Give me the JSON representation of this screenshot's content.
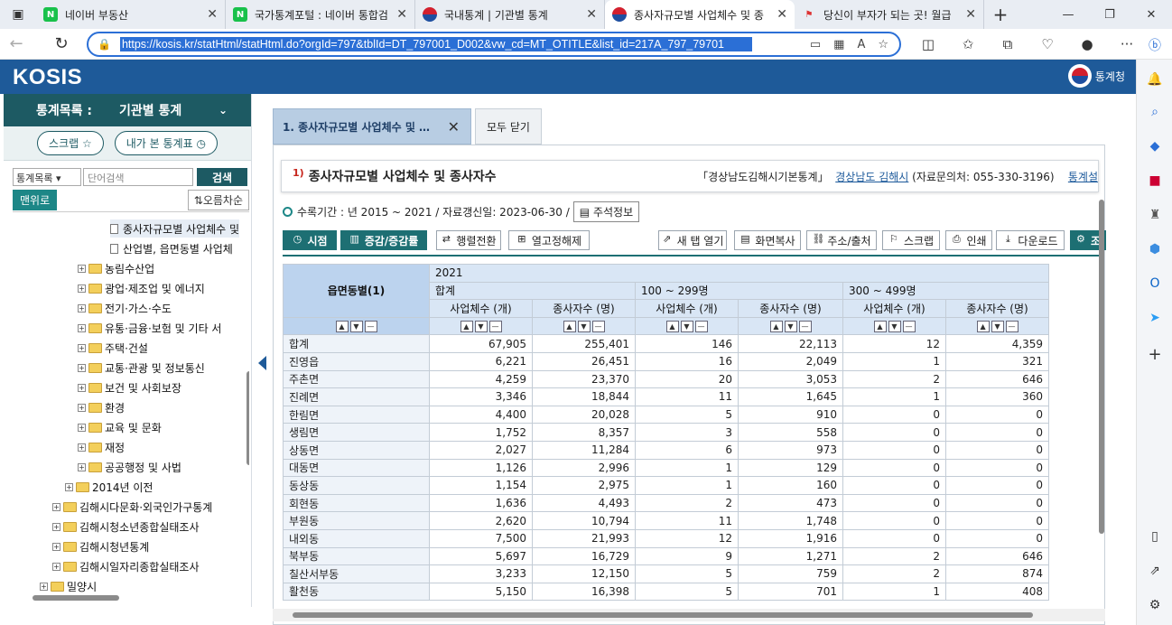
{
  "browser": {
    "tabs": [
      {
        "title": "네이버 부동산",
        "favicon": "N",
        "color": "#19c14b"
      },
      {
        "title": "국가통계포털 : 네이버 통합검",
        "favicon": "N",
        "color": "#19c14b"
      },
      {
        "title": "국내통계 | 기관별 통계",
        "favicon": "kosis-icon",
        "color": "#1e4fa0"
      },
      {
        "title": "종사자규모별 사업체수 및 종",
        "favicon": "kosis-icon",
        "color": "#1e4fa0"
      },
      {
        "title": "당신이 부자가 되는 곳! 월급",
        "favicon": "flag-icon",
        "color": "#d33"
      }
    ],
    "url": "https://kosis.kr/statHtml/statHtml.do?orgId=797&tblId=DT_797001_D002&vw_cd=MT_OTITLE&list_id=217A_797_79701"
  },
  "header": {
    "logo": "KOSIS",
    "org": "통계청"
  },
  "left": {
    "title": "통계목록 :",
    "selected": "기관별 통계",
    "scrap": "스크랩 ☆",
    "my_tables": "내가 본 통계표",
    "search_select": "통계목록",
    "search_placeholder": "단어검색",
    "search_btn": "검색",
    "menu_btn": "맨위로",
    "sort_btn": "오름차순",
    "tree": [
      {
        "label": "종사자규모별 사업체수 및",
        "type": "doc",
        "indent": 108,
        "selected": true
      },
      {
        "label": "산업별, 읍면동별 사업체",
        "type": "doc",
        "indent": 108
      },
      {
        "label": "농림수산업",
        "type": "folder",
        "indent": 86
      },
      {
        "label": "광업·제조업 및 에너지",
        "type": "folder",
        "indent": 86
      },
      {
        "label": "전기·가스·수도",
        "type": "folder",
        "indent": 86
      },
      {
        "label": "유통·금융·보험 및 기타 서",
        "type": "folder",
        "indent": 86
      },
      {
        "label": "주택·건설",
        "type": "folder",
        "indent": 86
      },
      {
        "label": "교통·관광 및 정보통신",
        "type": "folder",
        "indent": 86
      },
      {
        "label": "보건 및 사회보장",
        "type": "folder",
        "indent": 86
      },
      {
        "label": "환경",
        "type": "folder",
        "indent": 86
      },
      {
        "label": "교육 및 문화",
        "type": "folder",
        "indent": 86
      },
      {
        "label": "재정",
        "type": "folder",
        "indent": 86
      },
      {
        "label": "공공행정 및 사법",
        "type": "folder",
        "indent": 86
      },
      {
        "label": "2014년 이전",
        "type": "folder",
        "indent": 72
      },
      {
        "label": "김해시다문화·외국인가구통계",
        "type": "folder",
        "indent": 58
      },
      {
        "label": "김해시청소년종합실태조사",
        "type": "folder",
        "indent": 58
      },
      {
        "label": "김해시청년통계",
        "type": "folder",
        "indent": 58
      },
      {
        "label": "김해시일자리종합실태조사",
        "type": "folder",
        "indent": 58
      },
      {
        "label": "밀양시",
        "type": "folder",
        "indent": 44
      }
    ]
  },
  "main": {
    "tab_label": "1. 종사자규모별 사업체수 및 …",
    "close_all": "모두 닫기",
    "table_num": "1)",
    "table_title": "종사자규모별 사업체수 및 종사자수",
    "source_book": "「경상남도김해시기본통계」",
    "source_org": "경상남도 김해시",
    "source_contact": "(자료문의처: 055-330-3196)",
    "source_more": "통계설",
    "period": "수록기간 : 년 2015 ~ 2021 / 자료갱신일: 2023-06-30 /",
    "notes_btn": "주석정보",
    "buttons_left": [
      "시점",
      "증감/증감률",
      "행렬전환",
      "열고정해제"
    ],
    "buttons_right": [
      "새 탭 열기",
      "화면복사",
      "주소/출처",
      "스크랩",
      "인쇄",
      "다운로드",
      "조"
    ]
  },
  "table": {
    "row_header": "읍면동별(1)",
    "year": "2021",
    "groups": [
      "합계",
      "100 ~ 299명",
      "300 ~ 499명"
    ],
    "cols": [
      "사업체수 (개)",
      "종사자수 (명)",
      "사업체수 (개)",
      "종사자수 (명)",
      "사업체수 (개)",
      "종사자수 (명)"
    ],
    "rows": [
      [
        "합계",
        "67,905",
        "255,401",
        "146",
        "22,113",
        "12",
        "4,359"
      ],
      [
        "진영읍",
        "6,221",
        "26,451",
        "16",
        "2,049",
        "1",
        "321"
      ],
      [
        "주촌면",
        "4,259",
        "23,370",
        "20",
        "3,053",
        "2",
        "646"
      ],
      [
        "진례면",
        "3,346",
        "18,844",
        "11",
        "1,645",
        "1",
        "360"
      ],
      [
        "한림면",
        "4,400",
        "20,028",
        "5",
        "910",
        "0",
        "0"
      ],
      [
        "생림면",
        "1,752",
        "8,357",
        "3",
        "558",
        "0",
        "0"
      ],
      [
        "상동면",
        "2,027",
        "11,284",
        "6",
        "973",
        "0",
        "0"
      ],
      [
        "대동면",
        "1,126",
        "2,996",
        "1",
        "129",
        "0",
        "0"
      ],
      [
        "동상동",
        "1,154",
        "2,975",
        "1",
        "160",
        "0",
        "0"
      ],
      [
        "회현동",
        "1,636",
        "4,493",
        "2",
        "473",
        "0",
        "0"
      ],
      [
        "부원동",
        "2,620",
        "10,794",
        "11",
        "1,748",
        "0",
        "0"
      ],
      [
        "내외동",
        "7,500",
        "21,993",
        "12",
        "1,916",
        "0",
        "0"
      ],
      [
        "북부동",
        "5,697",
        "16,729",
        "9",
        "1,271",
        "2",
        "646"
      ],
      [
        "칠산서부동",
        "3,233",
        "12,150",
        "5",
        "759",
        "2",
        "874"
      ],
      [
        "활천동",
        "5,150",
        "16,398",
        "5",
        "701",
        "1",
        "408"
      ]
    ]
  },
  "colors": {
    "kosis_blue": "#1e5a99",
    "teal": "#1d6f73",
    "header_cell": "#d9e6f5"
  }
}
